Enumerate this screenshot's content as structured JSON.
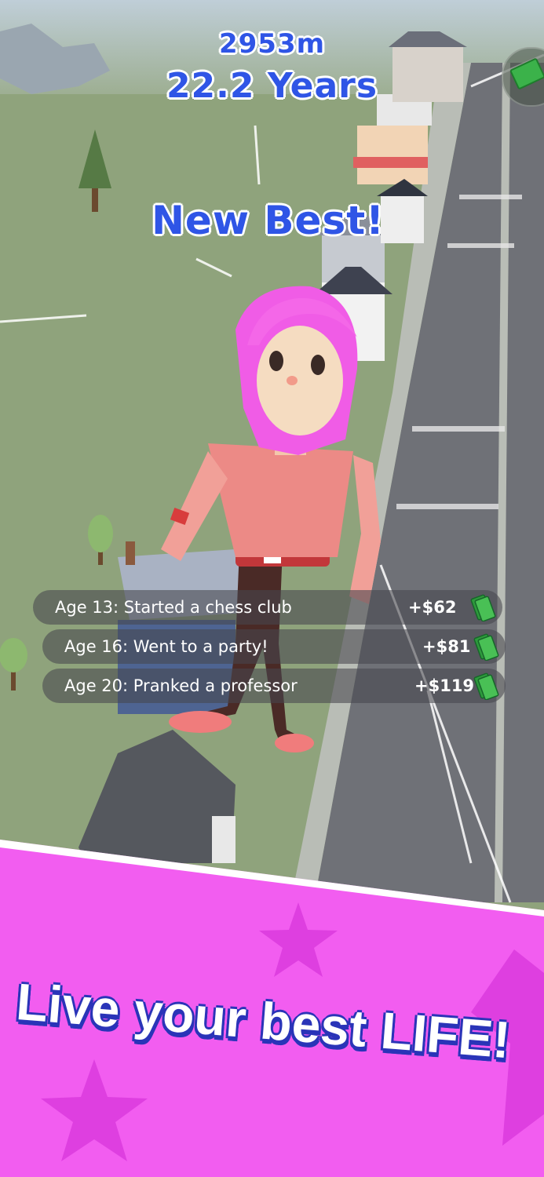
{
  "hud": {
    "distance": "2953m",
    "years": "22.2 Years",
    "new_best": "New Best!"
  },
  "events": [
    {
      "label": "Age 13: Started a chess club",
      "amount": "+$62"
    },
    {
      "label": "Age 16: Went to a party!",
      "amount": "+$81"
    },
    {
      "label": "Age 20: Pranked a professor",
      "amount": "+$119"
    }
  ],
  "promo": {
    "slogan": "Live your best LIFE!"
  },
  "colors": {
    "hud_blue": "#2f55e6",
    "promo_pink": "#f25df0",
    "money_green": "#3bb24a",
    "hair_pink": "#f05ce6"
  },
  "icons": [
    "cash-icon",
    "money-stack-icon",
    "star-icon"
  ]
}
